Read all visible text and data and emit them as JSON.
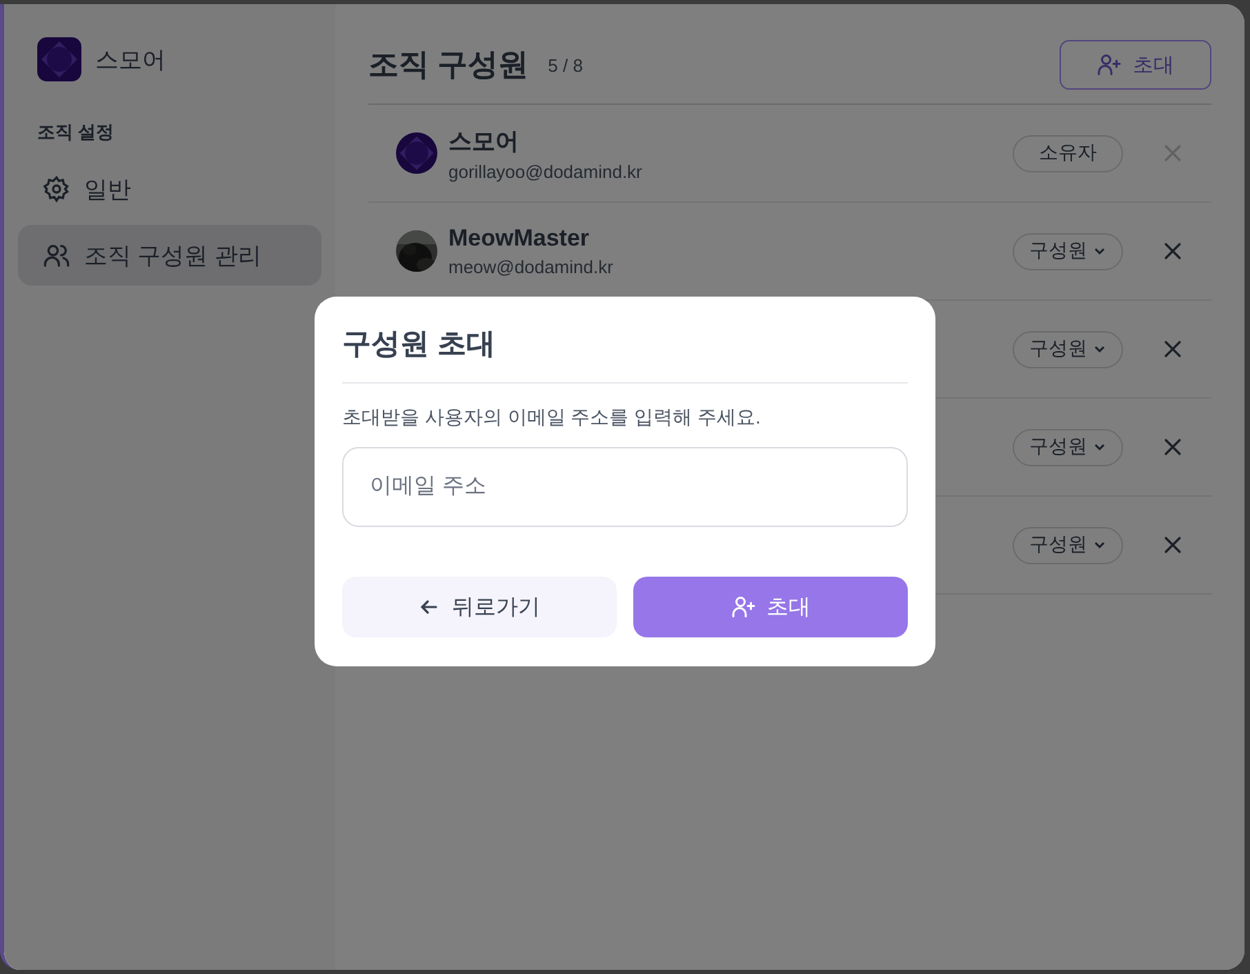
{
  "sidebar": {
    "org_name": "스모어",
    "section_title": "조직 설정",
    "items": [
      {
        "label": "일반",
        "selected": false
      },
      {
        "label": "조직 구성원 관리",
        "selected": true
      }
    ]
  },
  "header": {
    "title": "조직 구성원",
    "count": "5 / 8",
    "invite_button": "초대"
  },
  "members": [
    {
      "name": "스모어",
      "email": "gorillayoo@dodamind.kr",
      "avatar": {
        "kind": "logo"
      },
      "role": "소유자",
      "kind": "owner",
      "removable": false
    },
    {
      "name": "MeowMaster",
      "email": "meow@dodamind.kr",
      "role": "구성원",
      "kind": "member",
      "removable": true
    },
    {
      "role": "구성원",
      "kind": "member",
      "removable": true
    },
    {
      "role": "구성원",
      "kind": "member",
      "removable": true
    },
    {
      "role": "구성원",
      "kind": "member",
      "removable": true
    }
  ],
  "dialog": {
    "title": "구성원 초대",
    "description": "초대받을 사용자의 이메일 주소를 입력해 주세요.",
    "email_field": {
      "placeholder": "이메일 주소"
    },
    "back_button": "뒤로가기",
    "invite_button": "초대"
  }
}
